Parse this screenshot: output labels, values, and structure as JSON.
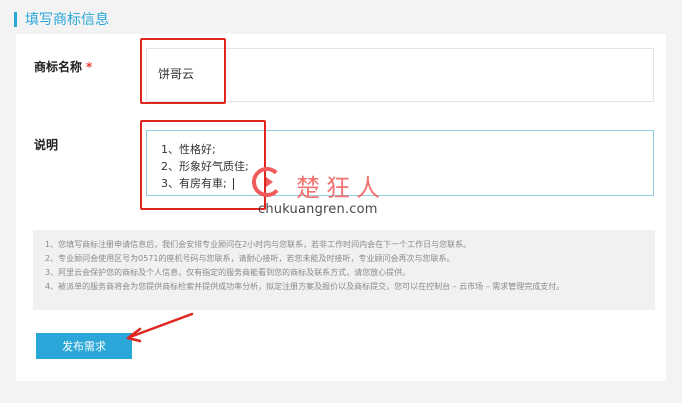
{
  "section": {
    "title": "填写商标信息"
  },
  "form": {
    "name_label": "商标名称",
    "name_required": "*",
    "name_value": "饼哥云",
    "desc_label": "说明",
    "desc_lines": [
      "1、性格好;",
      "2、形象好气质佳;",
      "3、有房有車;"
    ]
  },
  "notes": [
    "1、您填写商标注册申请信息后，我们会安排专业顾问在2小时内与您联系，若非工作时间内会在下一个工作日与您联系。",
    "2、专业顾问会使用区号为0571的座机号码与您联系，请耐心接听，若您未能及时接听，专业顾问会再次与您联系。",
    "3、阿里云会保护您的商标及个人信息，仅有指定的服务商能看到您的商标及联系方式，请您放心提供。",
    "4、被派单的服务商将会为您提供商标检索并提供成功率分析，拟定注册方案及报价以及商标提交，您可以在控制台 – 云市场 – 需求管理完成支付。"
  ],
  "submit_label": "发布需求",
  "watermark": {
    "cn": "楚狂人",
    "en": "chukuangren.com"
  },
  "colors": {
    "accent": "#2aa7d8",
    "annotation": "#e0241f",
    "watermark": "#f25b5b"
  }
}
